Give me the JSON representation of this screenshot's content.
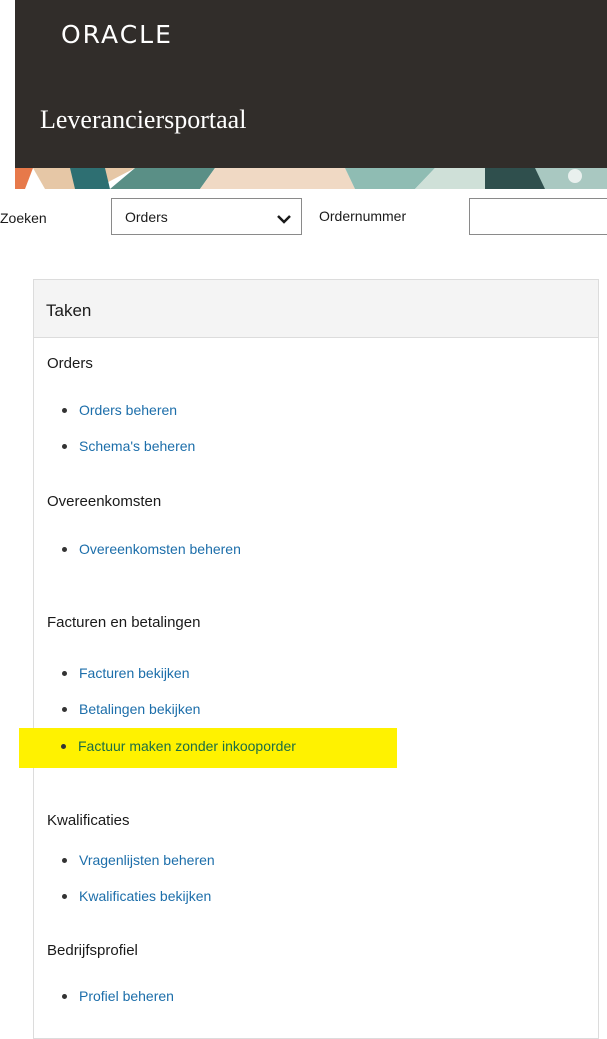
{
  "header": {
    "logo": "ORACLE",
    "title": "Leveranciersportaal"
  },
  "search": {
    "label": "Zoeken",
    "selected": "Orders",
    "field_label": "Ordernummer",
    "field_value": ""
  },
  "tasks": {
    "title": "Taken",
    "sections": [
      {
        "heading": "Orders",
        "items": [
          "Orders beheren",
          "Schema's beheren"
        ]
      },
      {
        "heading": "Overeenkomsten",
        "items": [
          "Overeenkomsten beheren"
        ]
      },
      {
        "heading": "Facturen en betalingen",
        "items": [
          "Facturen bekijken",
          "Betalingen bekijken",
          "Factuur maken zonder inkooporder"
        ]
      },
      {
        "heading": "Kwalificaties",
        "items": [
          "Vragenlijsten beheren",
          "Kwalificaties bekijken"
        ]
      },
      {
        "heading": "Bedrijfsprofiel",
        "items": [
          "Profiel beheren"
        ]
      }
    ]
  },
  "colors": {
    "header_bg": "#312d2a",
    "link": "#1c6eaa",
    "highlight": "#fff200"
  }
}
